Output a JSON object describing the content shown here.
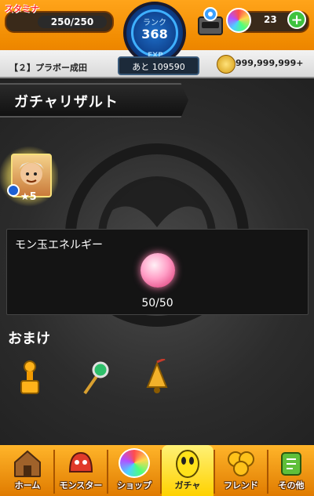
{
  "hud": {
    "stamina_label": "スタミナ",
    "stamina_value": "250/250",
    "stamina_fraction": 1.0,
    "rank_label": "ランク",
    "rank_value": "368",
    "exp_tag": "EXP",
    "exp_value": "あと 109590",
    "stage": "【２】プラボー成田",
    "orb_count": "23",
    "plus_label": "+",
    "coin_value": "999,999,999+"
  },
  "title": "ガチャリザルト",
  "result": {
    "card_stars": "★5",
    "energy_title": "モン玉エネルギー",
    "energy_value": "50/50",
    "bonus_title": "おまけ"
  },
  "nav": [
    {
      "label": "ホーム",
      "icon": "house-icon",
      "active": false
    },
    {
      "label": "モンスター",
      "icon": "monster-icon",
      "active": false
    },
    {
      "label": "ショップ",
      "icon": "rainbow-orb-icon",
      "active": false
    },
    {
      "label": "ガチャ",
      "icon": "gacha-egg-icon",
      "active": true
    },
    {
      "label": "フレンド",
      "icon": "balloon-icon",
      "active": false
    },
    {
      "label": "その他",
      "icon": "other-icon",
      "active": false
    }
  ],
  "colors": {
    "accent_orange": "#f08a00",
    "active_yellow": "#ffd200"
  }
}
